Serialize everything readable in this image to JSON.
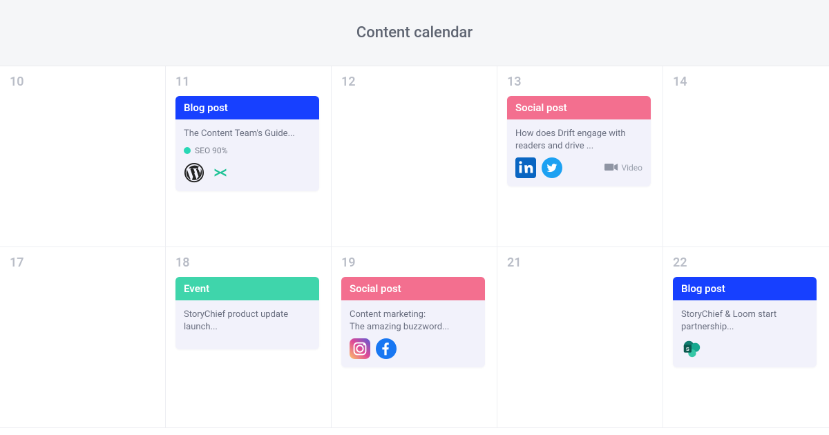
{
  "header": {
    "title": "Content calendar"
  },
  "days": {
    "r0c0": {
      "num": "10"
    },
    "r0c1": {
      "num": "11"
    },
    "r0c2": {
      "num": "12"
    },
    "r0c3": {
      "num": "13"
    },
    "r0c4": {
      "num": "14"
    },
    "r1c0": {
      "num": "17"
    },
    "r1c1": {
      "num": "18"
    },
    "r1c2": {
      "num": "19"
    },
    "r1c3": {
      "num": "21"
    },
    "r1c4": {
      "num": "22"
    }
  },
  "cards": {
    "blog1": {
      "type_label": "Blog post",
      "title": "The Content Team's Guide...",
      "seo_label": "SEO 90%",
      "channels": [
        "wordpress",
        "medium"
      ]
    },
    "social1": {
      "type_label": "Social post",
      "title": "How does Drift engage with readers and drive ...",
      "channels": [
        "linkedin",
        "twitter"
      ],
      "attachment_label": "Video"
    },
    "event1": {
      "type_label": "Event",
      "title": "StoryChief product update launch..."
    },
    "social2": {
      "type_label": "Social post",
      "title": "Content marketing:\nThe amazing buzzword...",
      "channels": [
        "instagram",
        "facebook"
      ]
    },
    "blog2": {
      "type_label": "Blog post",
      "title": "StoryChief & Loom start partnership...",
      "channels": [
        "sharepoint"
      ]
    }
  },
  "colors": {
    "blog": "#1740ff",
    "social": "#f36f8f",
    "event": "#3fd5ab",
    "seo_dot": "#28d7b5"
  }
}
